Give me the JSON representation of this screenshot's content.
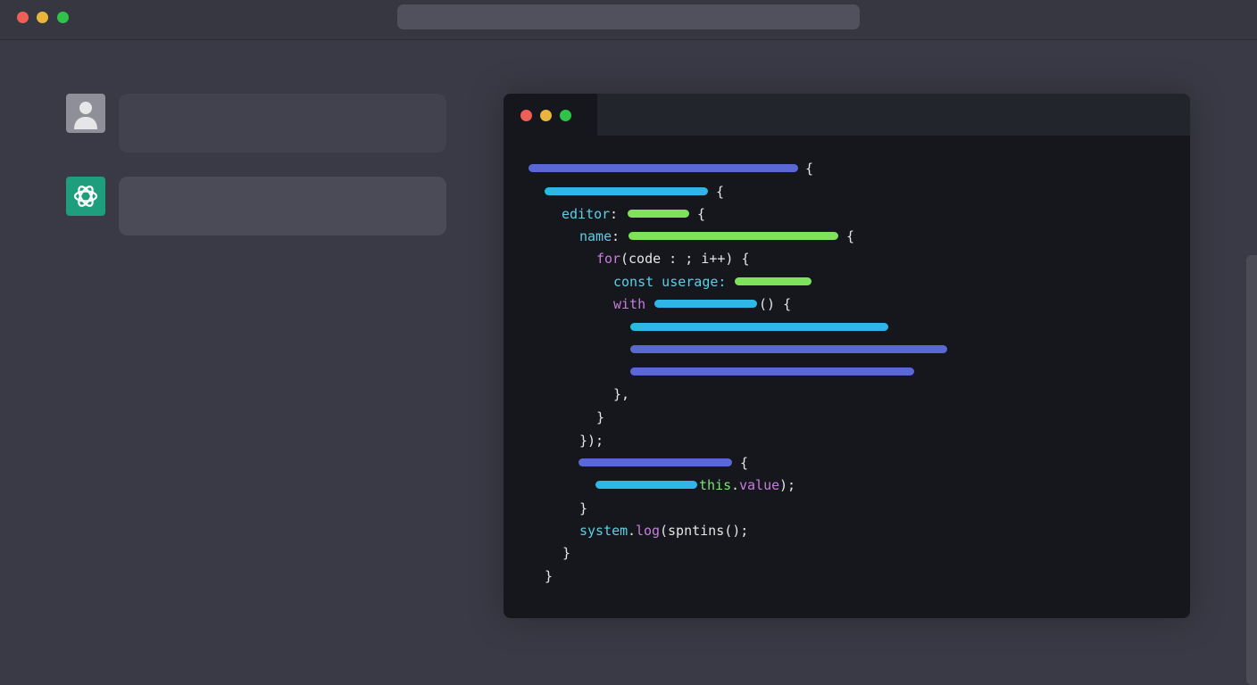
{
  "colors": {
    "traffic_red": "#ee5f58",
    "traffic_yellow": "#e9b53c",
    "traffic_green": "#2fc34a",
    "bar_purple": "#5a68d6",
    "bar_blue": "#2eb7e6",
    "bar_green": "#7ee25a",
    "bot_avatar": "#1f9e7e"
  },
  "chat": {
    "user_avatar_icon": "user-silhouette-icon",
    "bot_avatar_icon": "assistant-logo-icon"
  },
  "code": {
    "l1_brace": "{",
    "l2_brace": "{",
    "l3_key": "editor",
    "l3_colon": ":",
    "l3_brace": "{",
    "l4_key": "name",
    "l4_colon": ":",
    "l4_brace": "{",
    "l5_kw": "for",
    "l5_rest": " (code : ; i++) {",
    "l6_text": "const userage:",
    "l7_kw": "with",
    "l7_rest": "() {",
    "l11_text": "},",
    "l12_text": "}",
    "l13_text": "});",
    "l14_brace": "{",
    "l15_this": "this",
    "l15_dot": ".",
    "l15_value": "value",
    "l15_end": ");",
    "l16_text": "}",
    "l17_obj": "system",
    "l17_dot": ".",
    "l17_log": "log",
    "l17_rest": "(spntins();",
    "l18_text": "}",
    "l19_text": "}"
  }
}
